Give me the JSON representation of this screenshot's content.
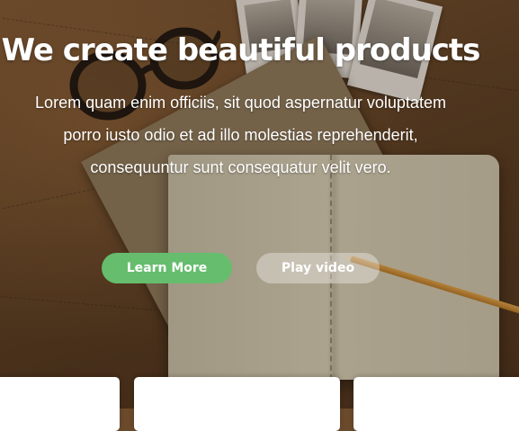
{
  "hero": {
    "title": "We create beautiful products",
    "subtitle": "Lorem quam enim officiis, sit quod aspernatur voluptatem porro iusto odio et ad illo molestias reprehenderit, consequuntur sunt consequatur velit vero."
  },
  "buttons": {
    "learn_more": "Learn More",
    "play_video": "Play video"
  },
  "colors": {
    "primary_button": "#66bd6d",
    "secondary_button": "rgba(255,255,255,0.35)",
    "text": "#ffffff"
  },
  "background_image": "desk-with-map-glasses-notebook-pencil"
}
